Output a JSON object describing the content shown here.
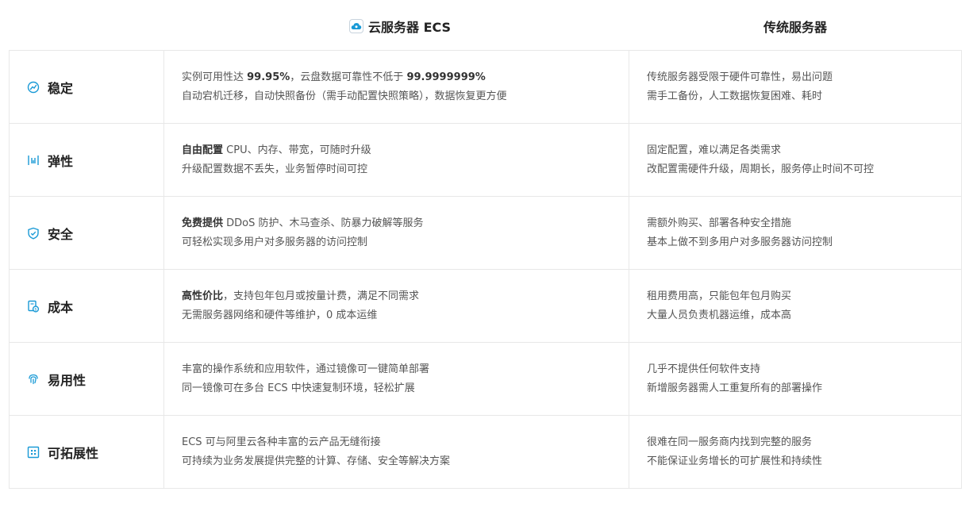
{
  "header": {
    "ecs_title": "云服务器 ECS",
    "trad_title": "传统服务器",
    "ecs_logo_icon": "cloud-icon",
    "accent": "#1a9ad6"
  },
  "rows": [
    {
      "icon": "speedometer-icon",
      "category": "稳定",
      "ecs": [
        {
          "pre": "实例可用性达 ",
          "bold": "99.95%",
          "post": "，云盘数据可靠性不低于 ",
          "bold2": "99.9999999%"
        },
        {
          "pre": "",
          "bold": "",
          "post": "自动宕机迁移，自动快照备份（需手动配置快照策略），数据恢复更方便",
          "bold2": ""
        }
      ],
      "trad": [
        "传统服务器受限于硬件可靠性，易出问题",
        "需手工备份，人工数据恢复困难、耗时"
      ]
    },
    {
      "icon": "elastic-bars-icon",
      "category": "弹性",
      "ecs": [
        {
          "pre": "",
          "bold": "自由配置",
          "post": " CPU、内存、带宽，可随时升级",
          "bold2": ""
        },
        {
          "pre": "",
          "bold": "",
          "post": "升级配置数据不丢失，业务暂停时间可控",
          "bold2": ""
        }
      ],
      "trad": [
        "固定配置，难以满足各类需求",
        "改配置需硬件升级，周期长，服务停止时间不可控"
      ]
    },
    {
      "icon": "shield-check-icon",
      "category": "安全",
      "ecs": [
        {
          "pre": "",
          "bold": "免费提供",
          "post": " DDoS 防护、木马查杀、防暴力破解等服务",
          "bold2": ""
        },
        {
          "pre": "",
          "bold": "",
          "post": "可轻松实现多用户对多服务器的访问控制",
          "bold2": ""
        }
      ],
      "trad": [
        "需额外购买、部署各种安全措施",
        "基本上做不到多用户对多服务器访问控制"
      ]
    },
    {
      "icon": "cost-document-icon",
      "category": "成本",
      "ecs": [
        {
          "pre": "",
          "bold": "高性价比",
          "post": "，支持包年包月或按量计费，满足不同需求",
          "bold2": ""
        },
        {
          "pre": "",
          "bold": "",
          "post": "无需服务器网络和硬件等维护，0 成本运维",
          "bold2": ""
        }
      ],
      "trad": [
        "租用费用高，只能包年包月购买",
        "大量人员负责机器运维，成本高"
      ]
    },
    {
      "icon": "fingerprint-icon",
      "category": "易用性",
      "ecs": [
        {
          "pre": "",
          "bold": "",
          "post": "丰富的操作系统和应用软件，通过镜像可一键简单部署",
          "bold2": ""
        },
        {
          "pre": "",
          "bold": "",
          "post": "同一镜像可在多台 ECS 中快速复制环境，轻松扩展",
          "bold2": ""
        }
      ],
      "trad": [
        "几乎不提供任何软件支持",
        "新增服务器需人工重复所有的部署操作"
      ]
    },
    {
      "icon": "expand-grid-icon",
      "category": "可拓展性",
      "ecs": [
        {
          "pre": "",
          "bold": "",
          "post": "ECS 可与阿里云各种丰富的云产品无缝衔接",
          "bold2": ""
        },
        {
          "pre": "",
          "bold": "",
          "post": "可持续为业务发展提供完整的计算、存储、安全等解决方案",
          "bold2": ""
        }
      ],
      "trad": [
        "很难在同一服务商内找到完整的服务",
        "不能保证业务增长的可扩展性和持续性"
      ]
    }
  ]
}
